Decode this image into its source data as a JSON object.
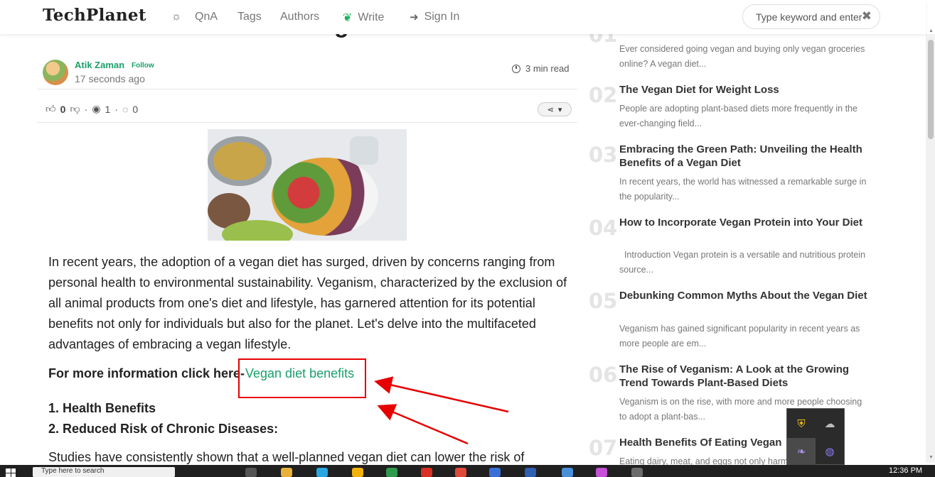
{
  "header": {
    "brand": "TechPlanet",
    "nav": {
      "qna": "QnA",
      "tags": "Tags",
      "authors": "Authors",
      "write": "Write",
      "signin": "Sign In"
    },
    "search_placeholder": "Type keyword and enter..."
  },
  "article": {
    "title_fragment": "g",
    "author_name": "Atik Zaman",
    "follow_label": "Follow",
    "posted": "17 seconds ago",
    "read_time": "3 min read",
    "likes": "0",
    "views": "1",
    "comments": "0",
    "intro": "In recent years, the adoption of a vegan diet has surged, driven by concerns ranging from personal health to environmental sustainability. Veganism, characterized by the exclusion of all animal products from one's diet and lifestyle, has garnered attention for its potential benefits not only for individuals but also for the planet. Let's delve into the multifaceted advantages of embracing a vegan lifestyle.",
    "more_info_label": "For more information click here-",
    "more_info_link": "Vegan diet benefits",
    "list": [
      "Health Benefits",
      "Reduced Risk of Chronic Diseases:"
    ],
    "cut_text": "Studies have consistently shown that a well-planned vegan diet can lower the risk of"
  },
  "sidebar": {
    "items": [
      {
        "num": "01",
        "title": "",
        "desc": "Ever considered going vegan and buying only vegan groceries online? A vegan diet..."
      },
      {
        "num": "02",
        "title": "The Vegan Diet for Weight Loss",
        "desc": "People are adopting plant-based diets more frequently in the ever-changing field..."
      },
      {
        "num": "03",
        "title": "Embracing the Green Path: Unveiling the Health Benefits of a Vegan Diet",
        "desc": "In recent years, the world has witnessed a remarkable surge in the popularity..."
      },
      {
        "num": "04",
        "title": "How to Incorporate Vegan Protein into Your Diet",
        "desc": "  Introduction Vegan protein is a versatile and nutritious protein source..."
      },
      {
        "num": "05",
        "title": "Debunking Common Myths About the Vegan Diet",
        "desc": "Veganism has gained significant popularity in recent years as more people are em..."
      },
      {
        "num": "06",
        "title": "The Rise of Veganism: A Look at the Growing Trend Towards Plant-Based Diets",
        "desc": "Veganism is on the rise, with more and more people choosing to adopt a plant-bas..."
      },
      {
        "num": "07",
        "title": "Health Benefits Of Eating Vegan",
        "desc": "Eating dairy, meat, and eggs not only harm the"
      }
    ]
  },
  "taskbar": {
    "search_text": "Type here to search",
    "time": "12:36 PM"
  },
  "colors": {
    "accent": "#1aa06b",
    "annotation": "#e60000"
  }
}
